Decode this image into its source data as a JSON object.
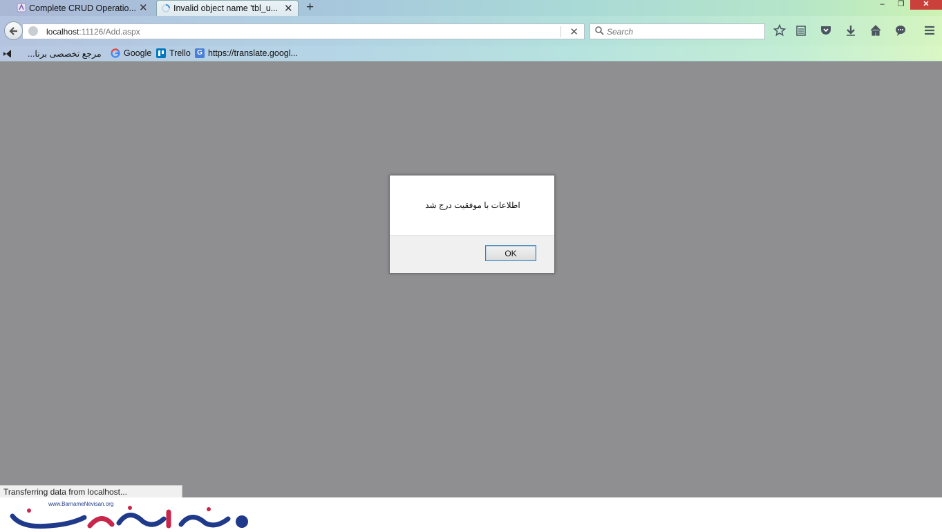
{
  "tabs": [
    {
      "label": "Complete CRUD Operatio...",
      "active": false
    },
    {
      "label": "Invalid object name 'tbl_u...",
      "active": true
    }
  ],
  "window_controls": {
    "minimize": "–",
    "maximize": "❐",
    "close": "✕"
  },
  "navbar": {
    "url_host": "localhost",
    "url_rest": ":11126/Add.aspx",
    "search_placeholder": "Search",
    "icons": [
      "bookmark-star-icon",
      "reading-list-icon",
      "pocket-icon",
      "download-icon",
      "home-icon",
      "chat-icon",
      "menu-icon"
    ]
  },
  "bookmarks": [
    {
      "label": "...مرجع تخصصی برنا"
    },
    {
      "label": "Google"
    },
    {
      "label": "Trello"
    },
    {
      "label": "https://translate.googl..."
    }
  ],
  "dialog": {
    "message": "اطلاعات با موفقیت درج شد",
    "ok_label": "OK"
  },
  "status": {
    "text": "Transferring data from localhost..."
  },
  "watermark": {
    "url": "www.BarnameNevisan.org"
  },
  "colors": {
    "page_overlay": "#8f8f91",
    "close_button": "#c9413a",
    "ok_border": "#3c7fb1"
  }
}
